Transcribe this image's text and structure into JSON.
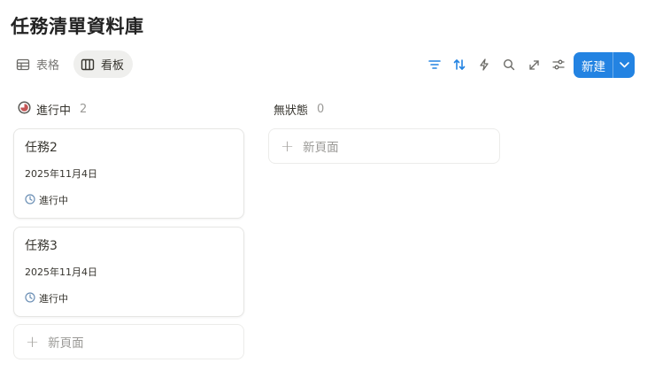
{
  "page": {
    "title": "任務清單資料庫"
  },
  "views": [
    {
      "label": "表格",
      "icon": "table-icon",
      "active": false
    },
    {
      "label": "看板",
      "icon": "board-icon",
      "active": true
    }
  ],
  "toolbar": {
    "icons": [
      "filter-icon",
      "sort-icon",
      "automation-icon",
      "search-icon",
      "expand-icon",
      "settings-icon"
    ],
    "accent_color": "#2383e2",
    "new_label": "新建"
  },
  "board": {
    "columns": [
      {
        "name": "進行中",
        "count": "2",
        "cards": [
          {
            "title": "任務2",
            "date": "2025年11月4日",
            "status": "進行中"
          },
          {
            "title": "任務3",
            "date": "2025年11月4日",
            "status": "進行中"
          }
        ],
        "add_label": "新頁面"
      },
      {
        "name": "無狀態",
        "count": "0",
        "cards": [],
        "add_label": "新頁面"
      }
    ]
  }
}
